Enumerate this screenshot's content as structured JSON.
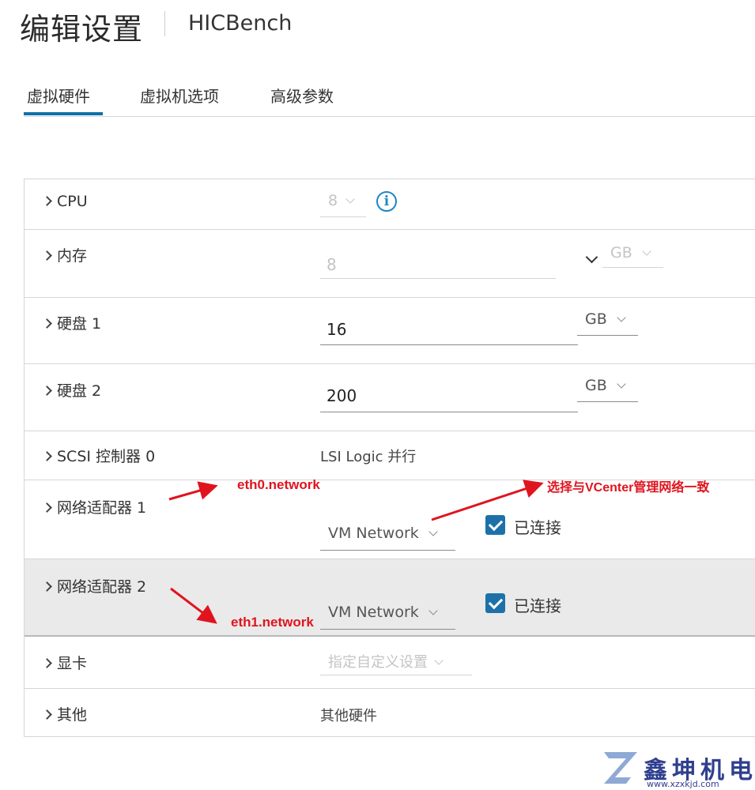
{
  "header": {
    "title": "编辑设置",
    "vm_name": "HICBench"
  },
  "tabs": [
    {
      "label": "虚拟硬件",
      "active": true
    },
    {
      "label": "虚拟机选项"
    },
    {
      "label": "高级参数"
    }
  ],
  "hardware": {
    "cpu": {
      "label": "CPU",
      "value": "8"
    },
    "memory": {
      "label": "内存",
      "value": "8",
      "unit": "GB"
    },
    "disk1": {
      "label": "硬盘 1",
      "value": "16",
      "unit": "GB"
    },
    "disk2": {
      "label": "硬盘 2",
      "value": "200",
      "unit": "GB"
    },
    "scsi": {
      "label": "SCSI 控制器 0",
      "value": "LSI Logic 并行"
    },
    "nic1": {
      "label": "网络适配器 1",
      "network": "VM Network",
      "connected_label": "已连接",
      "connected": true
    },
    "nic2": {
      "label": "网络适配器 2",
      "network": "VM Network",
      "connected_label": "已连接",
      "connected": true
    },
    "video": {
      "label": "显卡",
      "value": "指定自定义设置"
    },
    "other": {
      "label": "其他",
      "value": "其他硬件"
    }
  },
  "annotations": {
    "eth0": "eth0.network",
    "eth1": "eth1.network",
    "note": "选择与VCenter管理网络一致",
    "color": "#e0141e"
  },
  "watermark": {
    "brand": "鑫坤机电",
    "url": "www.xzxkjd.com"
  },
  "colors": {
    "accent": "#1c72a8",
    "info": "#1f86c4"
  }
}
